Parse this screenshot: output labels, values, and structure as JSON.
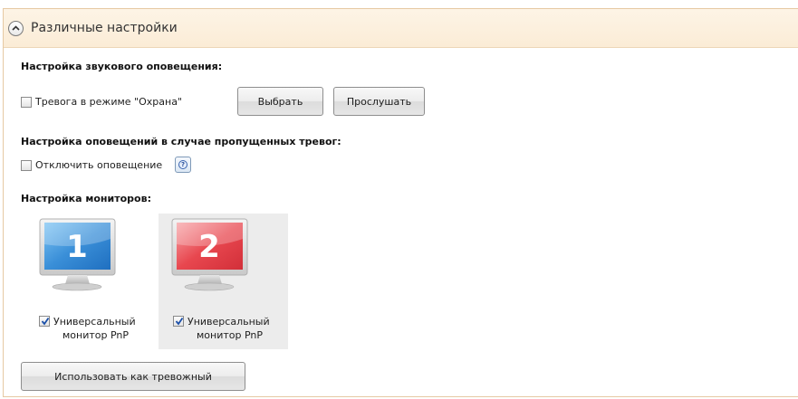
{
  "panel": {
    "title": "Различные настройки",
    "collapse_icon": "chevron-up-icon"
  },
  "sound": {
    "heading": "Настройка звукового оповещения:",
    "alarm_checkbox": {
      "label": "Тревога в режиме \"Охрана\"",
      "checked": false
    },
    "choose_label": "Выбрать",
    "listen_label": "Прослушать"
  },
  "missed": {
    "heading": "Настройка оповещений в случае пропущенных тревог:",
    "disable_checkbox": {
      "label": "Отключить оповещение",
      "checked": false
    },
    "help_icon": "help-icon",
    "help_glyph": "?"
  },
  "monitors": {
    "heading": "Настройка мониторов:",
    "items": [
      {
        "number": "1",
        "color": "#3a8fd8",
        "label_line1": "Универсальный",
        "label_line2": "монитор PnP",
        "checked": true,
        "selected": false
      },
      {
        "number": "2",
        "color": "#e8474f",
        "label_line1": "Универсальный",
        "label_line2": "монитор PnP",
        "checked": true,
        "selected": true
      }
    ],
    "use_as_alarm_label": "Использовать как тревожный"
  }
}
